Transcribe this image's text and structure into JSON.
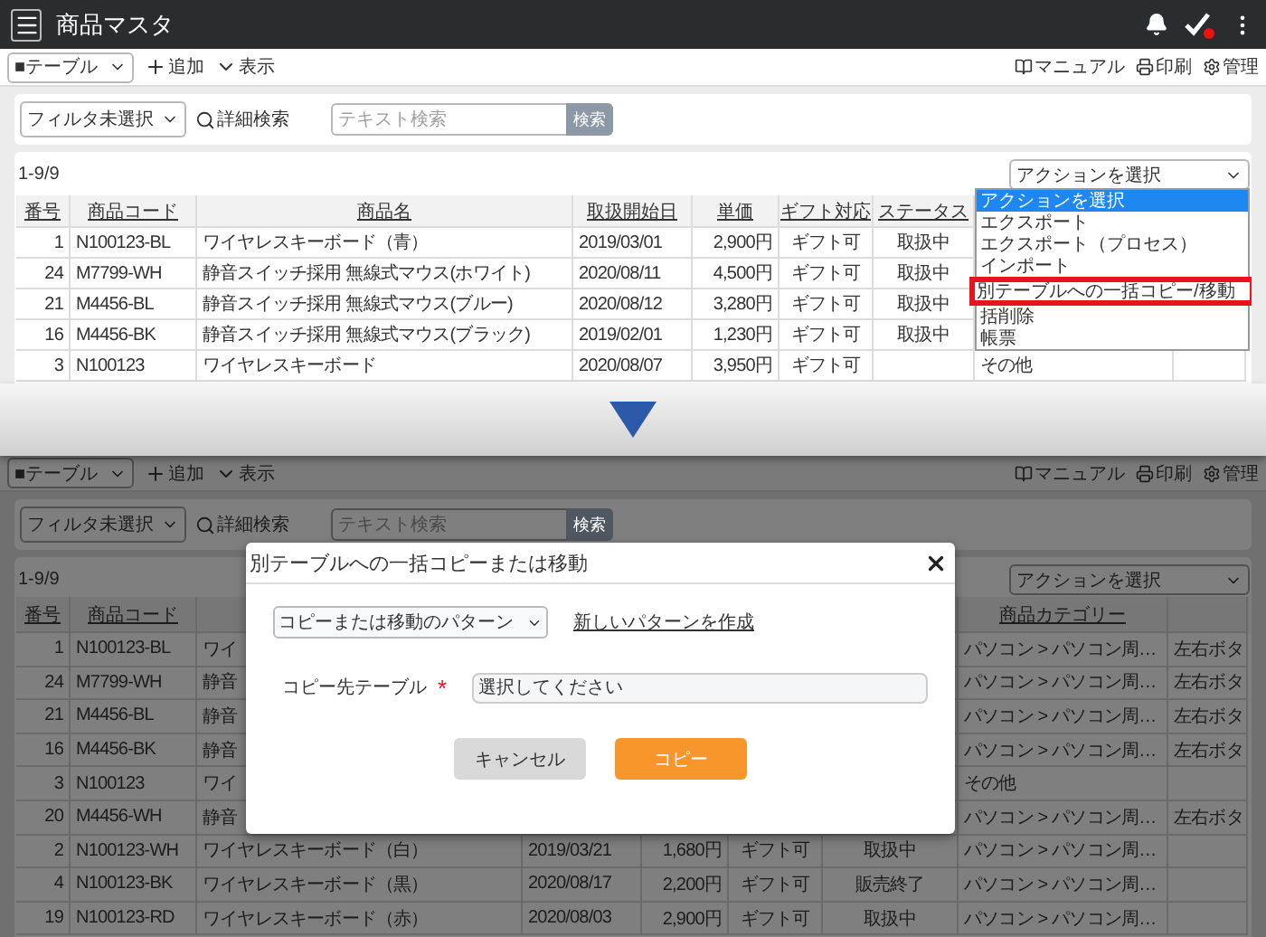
{
  "top": {
    "app_bar": {
      "title": "商品マスタ"
    },
    "toolbar": {
      "view_select": "■テーブル",
      "add": "追加",
      "view": "表示",
      "links": [
        "マニュアル",
        "印刷",
        "管理"
      ]
    },
    "filter": {
      "filter_select": "フィルタ未選択",
      "advanced": "詳細検索",
      "search_placeholder": "テキスト検索",
      "search_button": "検索"
    },
    "count": "1-9/9",
    "action_select": "アクションを選択",
    "action_menu": [
      {
        "label": "アクションを選択",
        "selected": true,
        "highlighted": false
      },
      {
        "label": "エクスポート",
        "selected": false,
        "highlighted": false
      },
      {
        "label": "エクスポート（プロセス）",
        "selected": false,
        "highlighted": false
      },
      {
        "label": "インポート",
        "selected": false,
        "highlighted": false
      },
      {
        "label": "別テーブルへの一括コピー/移動",
        "selected": false,
        "highlighted": true
      },
      {
        "label": "括削除",
        "selected": false,
        "highlighted": false
      },
      {
        "label": "帳票",
        "selected": false,
        "highlighted": false
      }
    ],
    "table": {
      "headers": {
        "no": "番号",
        "code": "商品コード",
        "name": "商品名",
        "date": "取扱開始日",
        "price": "単価",
        "gift": "ギフト対応",
        "status": "ステータス"
      },
      "rows": [
        {
          "no": "1",
          "code": "N100123-BL",
          "name": "ワイヤレスキーボード（青）",
          "date": "2019/03/01",
          "price": "2,900円",
          "gift": "ギフト可",
          "status": "取扱中"
        },
        {
          "no": "24",
          "code": "M7799-WH",
          "name": "静音スイッチ採用 無線式マウス(ホワイト)",
          "date": "2020/08/11",
          "price": "4,500円",
          "gift": "ギフト可",
          "status": "取扱中"
        },
        {
          "no": "21",
          "code": "M4456-BL",
          "name": "静音スイッチ採用 無線式マウス(ブルー)",
          "date": "2020/08/12",
          "price": "3,280円",
          "gift": "ギフト可",
          "status": "取扱中"
        },
        {
          "no": "16",
          "code": "M4456-BK",
          "name": "静音スイッチ採用 無線式マウス(ブラック)",
          "date": "2019/02/01",
          "price": "1,230円",
          "gift": "ギフト可",
          "status": "取扱中"
        },
        {
          "no": "3",
          "code": "N100123",
          "name": "ワイヤレスキーボード",
          "date": "2020/08/07",
          "price": "3,950円",
          "gift": "ギフト可",
          "category": "その他"
        }
      ]
    }
  },
  "bottom": {
    "toolbar": {
      "view_select": "■テーブル",
      "add": "追加",
      "view": "表示",
      "links": [
        "マニュアル",
        "印刷",
        "管理"
      ]
    },
    "filter": {
      "filter_select": "フィルタ未選択",
      "advanced": "詳細検索",
      "search_placeholder": "テキスト検索",
      "search_button": "検索"
    },
    "count": "1-9/9",
    "action_select": "アクションを選択",
    "table": {
      "headers": {
        "no": "番号",
        "code": "商品コード",
        "category": "商品カテゴリー"
      },
      "rows": [
        {
          "no": "1",
          "code": "N100123-BL",
          "name": "ワイ",
          "category": "パソコン > パソコン周…",
          "column_9": "左右ボタ"
        },
        {
          "no": "24",
          "code": "M7799-WH",
          "name": "静音",
          "category": "パソコン > パソコン周…",
          "column_9": "左右ボタ"
        },
        {
          "no": "21",
          "code": "M4456-BL",
          "name": "静音",
          "category": "パソコン > パソコン周…",
          "column_9": "左右ボタ"
        },
        {
          "no": "16",
          "code": "M4456-BK",
          "name": "静音",
          "category": "パソコン > パソコン周…",
          "column_9": "左右ボタ"
        },
        {
          "no": "3",
          "code": "N100123",
          "name": "ワイ",
          "category": "その他"
        },
        {
          "no": "20",
          "code": "M4456-WH",
          "name": "静音",
          "category": "パソコン > パソコン周…",
          "column_9": "左右ボタ"
        },
        {
          "no": "2",
          "code": "N100123-WH",
          "name": "ワイヤレスキーボード（白）",
          "date": "2019/03/21",
          "price": "1,680円",
          "gift": "ギフト可",
          "status": "取扱中",
          "category": "パソコン > パソコン周…"
        },
        {
          "no": "4",
          "code": "N100123-BK",
          "name": "ワイヤレスキーボード（黒）",
          "date": "2020/08/17",
          "price": "2,200円",
          "gift": "ギフト可",
          "status": "販売終了",
          "category": "パソコン > パソコン周…"
        },
        {
          "no": "19",
          "code": "N100123-RD",
          "name": "ワイヤレスキーボード（赤）",
          "date": "2020/08/03",
          "price": "2,900円",
          "gift": "ギフト可",
          "status": "取扱中",
          "category": "パソコン > パソコン周…"
        }
      ]
    },
    "dialog": {
      "title": "別テーブルへの一括コピーまたは移動",
      "pattern_select": "コピーまたは移動のパターン",
      "new_pattern_link": "新しいパターンを作成",
      "target_label": "コピー先テーブル",
      "required_mark": "*",
      "target_placeholder": "選択してください",
      "buttons": [
        {
          "label": "キャンセル",
          "kind": "secondary"
        },
        {
          "label": "コピー",
          "kind": "primary"
        }
      ]
    }
  }
}
